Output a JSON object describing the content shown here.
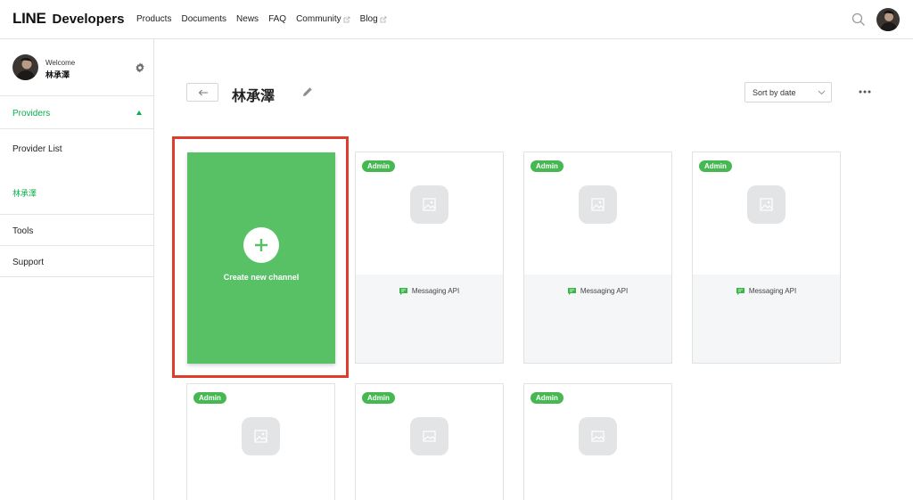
{
  "brand": {
    "line": "LINE",
    "developers": "Developers",
    "accent": "#06b04b"
  },
  "nav": [
    {
      "label": "Products",
      "external": false
    },
    {
      "label": "Documents",
      "external": false
    },
    {
      "label": "News",
      "external": false
    },
    {
      "label": "FAQ",
      "external": false
    },
    {
      "label": "Community",
      "external": true
    },
    {
      "label": "Blog",
      "external": true
    }
  ],
  "sidebar": {
    "welcome": "Welcome",
    "user_name": "林承澤",
    "providers_label": "Providers",
    "provider_list_label": "Provider List",
    "provider_item": "林承澤",
    "tools_label": "Tools",
    "support_label": "Support"
  },
  "main": {
    "title": "林承澤",
    "sort_label": "Sort by date",
    "create_label": "Create new channel",
    "highlight_color": "#e03c2c",
    "channels": [
      {
        "badge": "Admin",
        "type": "Messaging API"
      },
      {
        "badge": "Admin",
        "type": "Messaging API"
      },
      {
        "badge": "Admin",
        "type": "Messaging API"
      },
      {
        "badge": "Admin"
      },
      {
        "badge": "Admin"
      },
      {
        "badge": "Admin"
      }
    ]
  }
}
